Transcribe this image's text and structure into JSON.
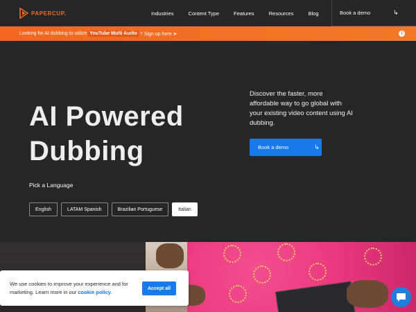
{
  "brand": {
    "name": "PAPERCUP.",
    "accent": "#f26a24"
  },
  "nav": {
    "links": [
      "Industries",
      "Content Type",
      "Features",
      "Resources",
      "Blog"
    ],
    "cta_label": "Book a demo",
    "cta_icon": "arrow-turn-icon"
  },
  "banner": {
    "prefix": "Looking for AI dubbing to utilize",
    "highlight": "YouTube Multi Audio",
    "suffix": "? Sign up here ➤",
    "info_icon": "info-icon"
  },
  "hero": {
    "title_line1": "AI Powered",
    "title_line2": "Dubbing",
    "description": "Discover the faster, more affordable way to go global with your existing video content using AI dubbing.",
    "cta_label": "Book a demo",
    "pick_label": "Pick a Language",
    "languages": [
      "English",
      "LATAM Spanish",
      "Brazilian Portuguese",
      "Italian"
    ],
    "selected_language": "Italian"
  },
  "cookie": {
    "text": "We use cookies to improve your experience and for marketing. Learn more in our ",
    "link": "cookie policy",
    "end": ".",
    "accept_label": "Accept all"
  },
  "chat": {
    "icon": "chat-bubble-icon"
  },
  "colors": {
    "background": "#262628",
    "primary_blue": "#1679ec",
    "orange": "#f26a24"
  }
}
